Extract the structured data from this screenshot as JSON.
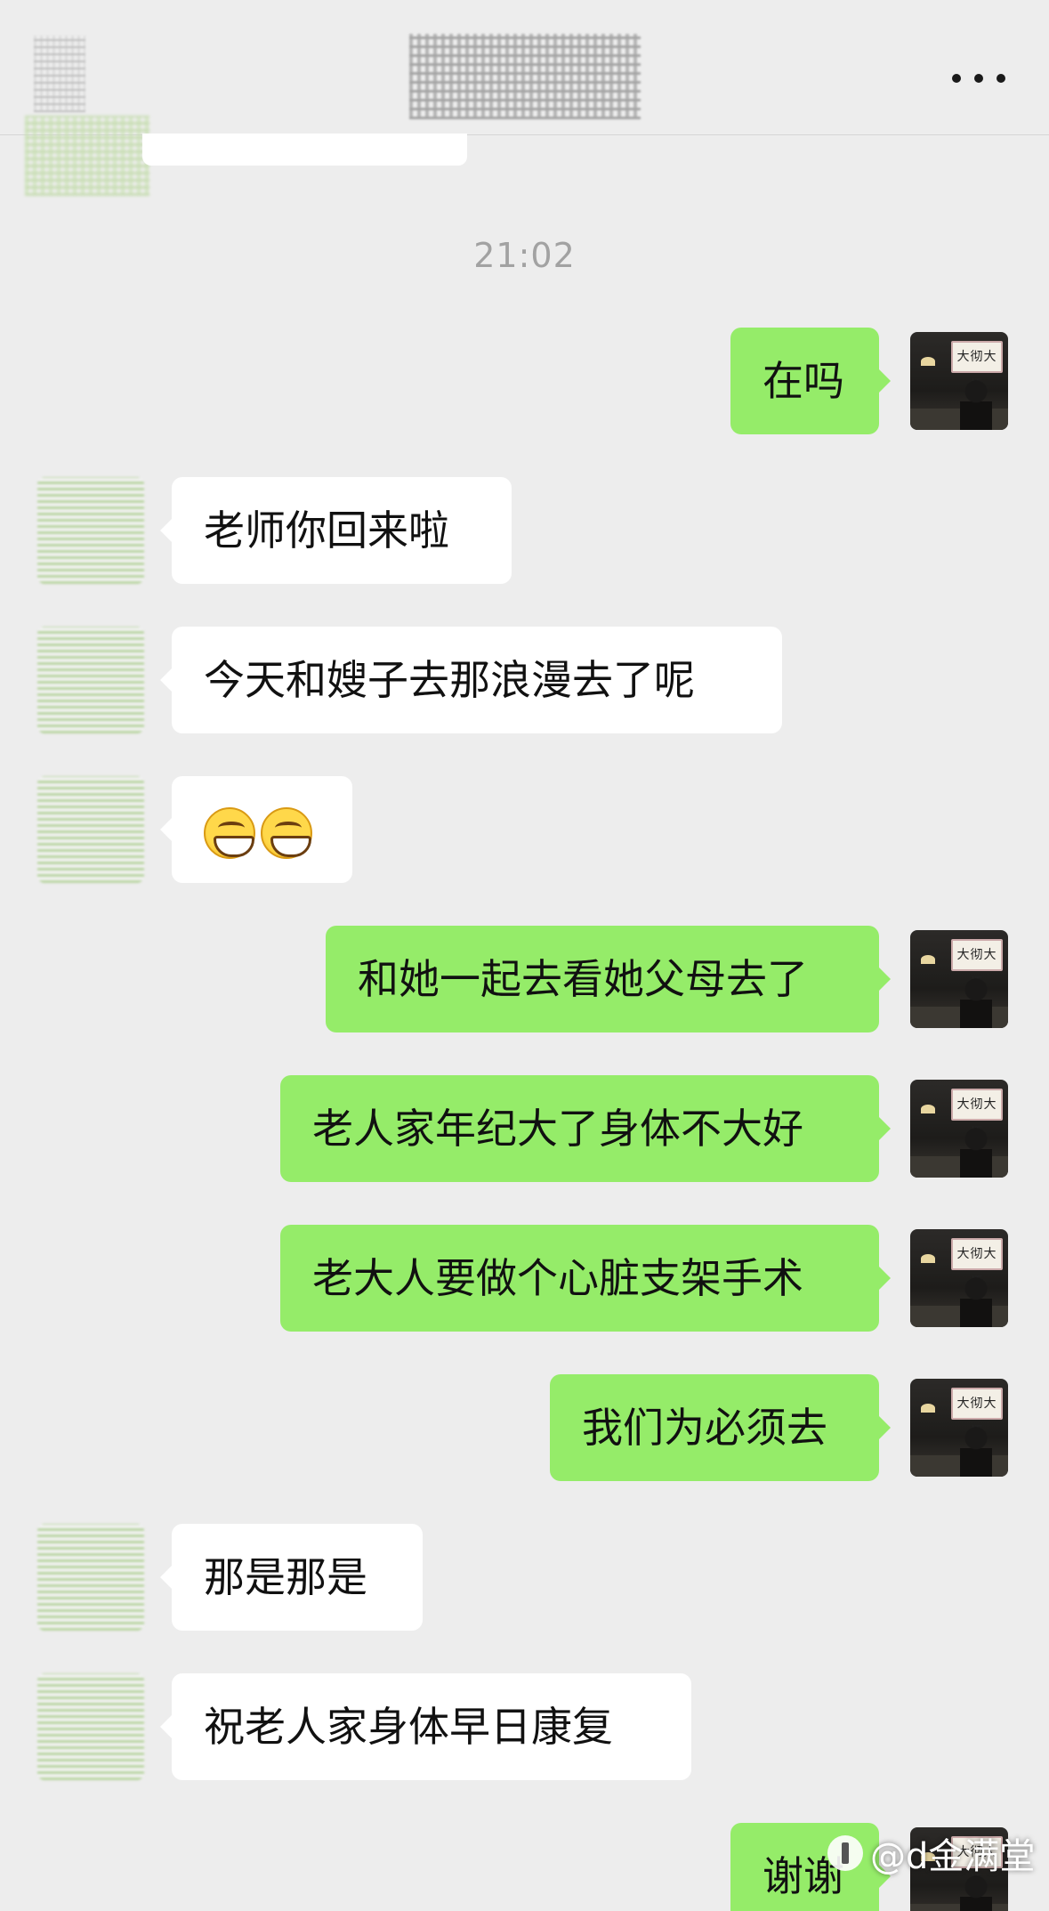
{
  "header": {
    "back_icon": "blurred-back-icon",
    "title_blurred": true,
    "more_icon": "more-dots-icon"
  },
  "timestamp": "21:02",
  "self_avatar": {
    "sign_text": "大彻大悟",
    "accent": "#95ec69"
  },
  "messages": [
    {
      "side": "self",
      "text": "在吗"
    },
    {
      "side": "peer",
      "text": "老师你回来啦"
    },
    {
      "side": "peer",
      "text": "今天和嫂子去那浪漫去了呢"
    },
    {
      "side": "peer",
      "text": "😁😁",
      "emoji": "grinning-face"
    },
    {
      "side": "self",
      "text": "和她一起去看她父母去了"
    },
    {
      "side": "self",
      "text": "老人家年纪大了身体不大好"
    },
    {
      "side": "self",
      "text": "老大人要做个心脏支架手术"
    },
    {
      "side": "self",
      "text": "我们为必须去"
    },
    {
      "side": "peer",
      "text": "那是那是"
    },
    {
      "side": "peer",
      "text": "祝老人家身体早日康复"
    },
    {
      "side": "self",
      "text": "谢谢"
    }
  ],
  "watermark": {
    "text": "@d金满堂"
  },
  "colors": {
    "self_bubble": "#95ec69",
    "peer_bubble": "#ffffff",
    "background": "#ededed"
  }
}
